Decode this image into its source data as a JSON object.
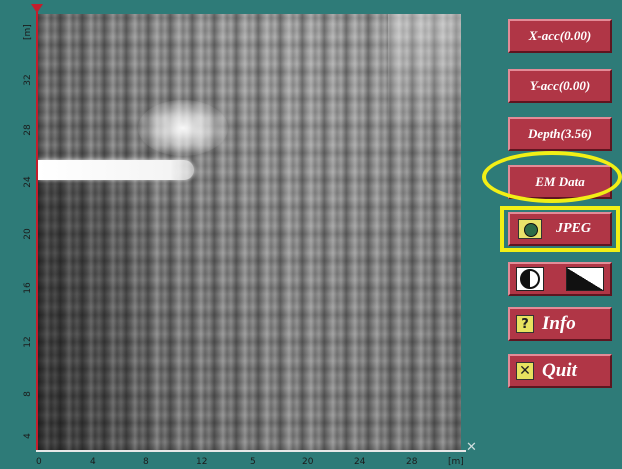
{
  "controls": {
    "x_acc": "X-acc(0.00)",
    "y_acc": "Y-acc(0.00)",
    "depth": "Depth(3.56)",
    "em_data": "EM Data",
    "jpeg": "JPEG",
    "info": "Info",
    "quit": "Quit"
  },
  "axes": {
    "x_ticks": [
      "0",
      "4",
      "8",
      "12",
      "5",
      "20",
      "24",
      "28"
    ],
    "x_end_label": "[m]",
    "y_ticks": [
      "[m]",
      "32",
      "28",
      "24",
      "20",
      "16",
      "12",
      "8",
      "4"
    ]
  },
  "colors": {
    "background": "#2e7b78",
    "button": "#b03646",
    "highlight": "#f2ef16",
    "axis": "#c41e2c"
  },
  "icons": {
    "jpeg": "camera-icon",
    "contrast": "half-circle-icon",
    "gradient": "ramp-icon",
    "info": "question-icon",
    "quit": "close-icon"
  }
}
